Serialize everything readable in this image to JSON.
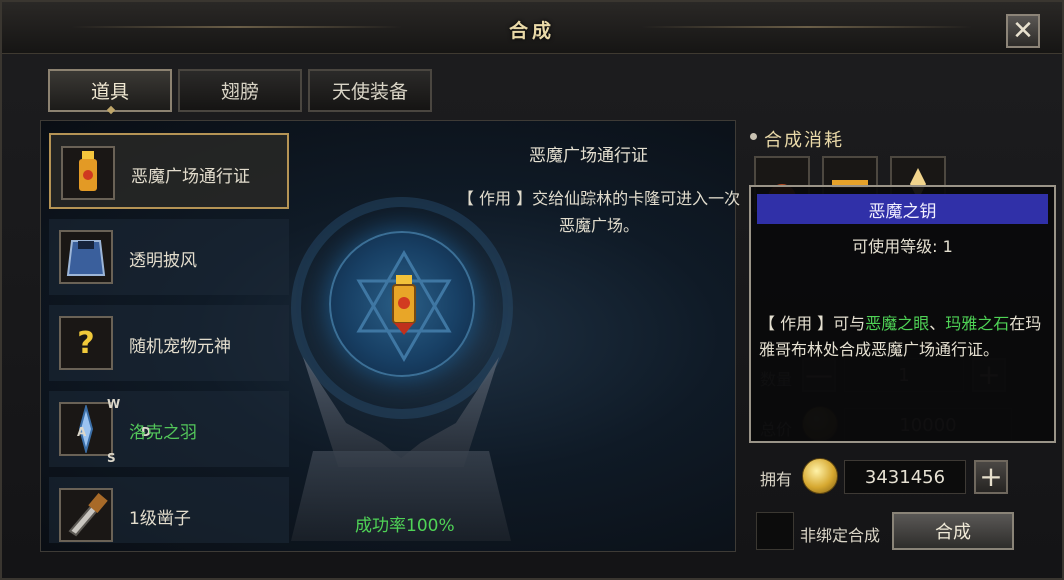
{
  "window": {
    "title": "合成",
    "close_glyph": "✕"
  },
  "tabs": [
    {
      "label": "道具",
      "active": true
    },
    {
      "label": "翅膀",
      "active": false
    },
    {
      "label": "天使装备",
      "active": false
    }
  ],
  "item_list": [
    {
      "label": "恶魔广场通行证",
      "icon": "ticket-scroll-icon",
      "selected": true,
      "color": "#e3ddcd"
    },
    {
      "label": "透明披风",
      "icon": "cape-icon",
      "selected": false,
      "color": "#e3ddcd"
    },
    {
      "label": "随机宠物元神",
      "icon": "question-mark-icon",
      "selected": false,
      "color": "#e3ddcd"
    },
    {
      "label": "洛克之羽",
      "icon": "compass-feather-icon",
      "selected": false,
      "color": "#53c75a",
      "compass": {
        "n": "W",
        "center": "D",
        "left": "A",
        "s": "S"
      }
    },
    {
      "label": "1级凿子",
      "icon": "chisel-icon",
      "selected": false,
      "color": "#e3ddcd"
    }
  ],
  "detail": {
    "title": "恶魔广场通行证",
    "description": "【 作用 】交给仙踪林的卡隆可进入一次恶魔广场。",
    "success_rate": "成功率100%"
  },
  "cost": {
    "title": "合成消耗",
    "slots": [
      "gear-material-icon",
      "bar-material-icon",
      "crystal-material-icon"
    ]
  },
  "form": {
    "quantity_label": "数量",
    "quantity_value": "1",
    "minus": "—",
    "plus": "+",
    "total_label": "总价",
    "total_value": "10000",
    "owned_label": "拥有",
    "owned_value": "3431456",
    "unbound_label": "非绑定合成",
    "synth_button": "合成"
  },
  "tooltip": {
    "name": "恶魔之钥",
    "level": "可使用等级: 1",
    "desc_prefix": "【 作用 】可与",
    "desc_hl1": "恶魔之眼",
    "desc_sep": "、",
    "desc_hl2": "玛雅之石",
    "desc_suffix": "在玛雅哥布林处合成恶魔广场通行证。"
  },
  "colors": {
    "accent_gold": "#e9d9a8",
    "highlight_green": "#4fd356",
    "tooltip_header": "#3030a8"
  }
}
